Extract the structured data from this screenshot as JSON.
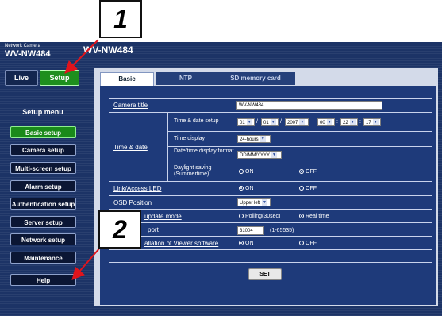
{
  "header": {
    "camera_label": "Network Camera",
    "camera_model": "WV-NW484",
    "title_model": "WV-NW484"
  },
  "top_buttons": {
    "live": "Live",
    "setup": "Setup"
  },
  "setup_menu": {
    "title": "Setup menu",
    "items": [
      {
        "label": "Basic setup"
      },
      {
        "label": "Camera setup"
      },
      {
        "label": "Multi-screen setup"
      },
      {
        "label": "Alarm setup"
      },
      {
        "label": "Authentication setup"
      },
      {
        "label": "Server setup"
      },
      {
        "label": "Network setup"
      },
      {
        "label": "Maintenance"
      }
    ],
    "help": "Help"
  },
  "tabs": [
    {
      "label": "Basic"
    },
    {
      "label": "NTP"
    },
    {
      "label": "SD memory card"
    }
  ],
  "form": {
    "camera_title": {
      "label": "Camera title",
      "value": "WV-NW484"
    },
    "time_date": {
      "label": "Time & date",
      "setup_label": "Time & date setup",
      "month": "01",
      "day": "01",
      "year": "2007",
      "hour": "00",
      "minute": "22",
      "second": "17",
      "sep_slash": "/",
      "sep_colon": ":",
      "display_label": "Time display",
      "display_value": "24-hours",
      "format_label": "Date/time display format",
      "format_value": "DD/MM/YYYY",
      "dst_label": "Daylight saving (Summertime)",
      "dst_on": "ON",
      "dst_off": "OFF"
    },
    "link_led": {
      "label": "Link/Access LED",
      "on": "ON",
      "off": "OFF"
    },
    "osd_position": {
      "label": "OSD Position",
      "value": "Upper left"
    },
    "update_mode": {
      "label": "update mode",
      "polling": "Polling(30sec)",
      "realtime": "Real time"
    },
    "port": {
      "label": "port",
      "value": "31004",
      "range": "(1-65535)"
    },
    "viewer": {
      "label": "allation of Viewer software",
      "on": "ON",
      "off": "OFF"
    },
    "set_button": "SET"
  },
  "callouts": {
    "one": "1",
    "two": "2"
  },
  "colors": {
    "accent_green": "#1e8f1e",
    "callout_arrow": "#e0141c",
    "panel_blue": "#1e3a7a"
  }
}
